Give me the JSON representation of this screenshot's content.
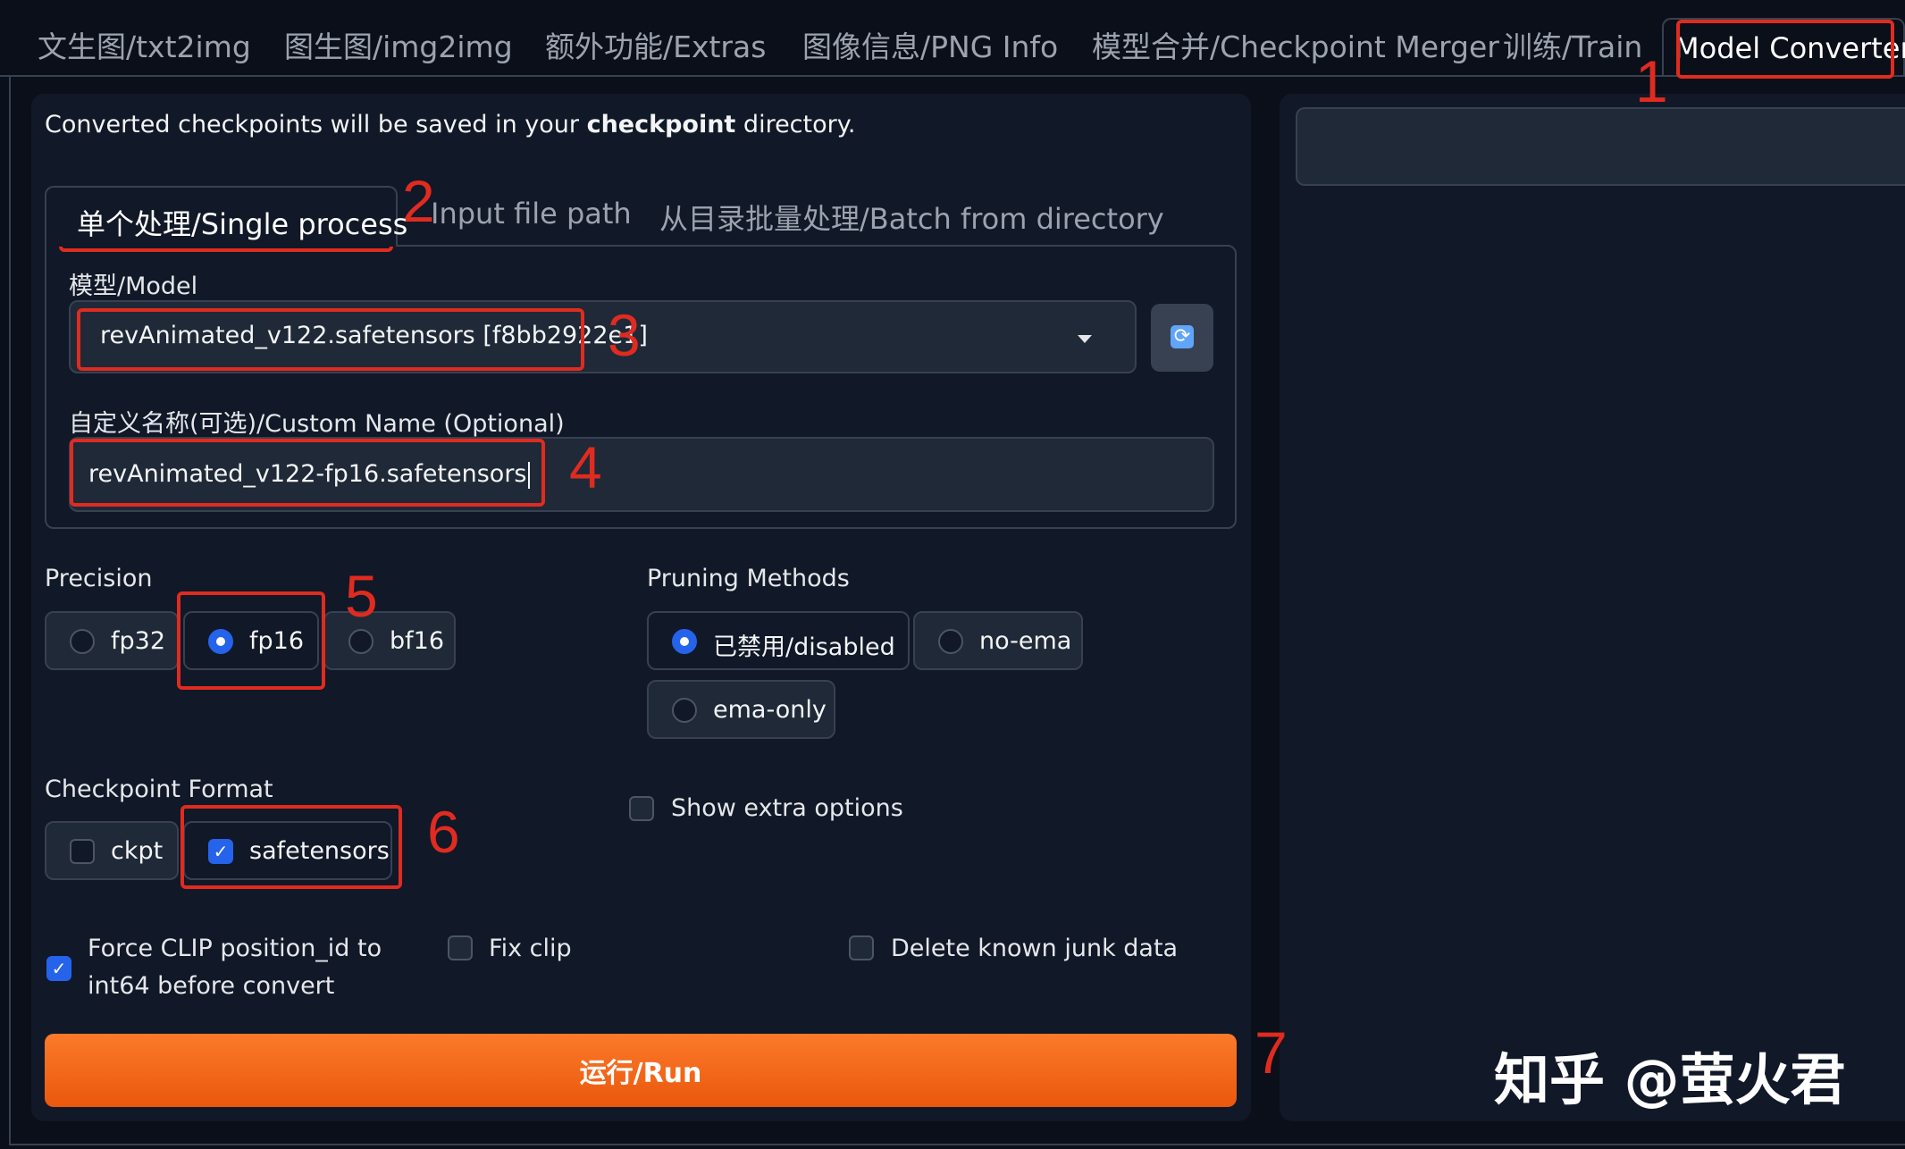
{
  "tabs": [
    {
      "label": "文生图/txt2img"
    },
    {
      "label": "图生图/img2img"
    },
    {
      "label": "额外功能/Extras"
    },
    {
      "label": "图像信息/PNG Info"
    },
    {
      "label": "模型合并/Checkpoint Merger"
    },
    {
      "label": "训练/Train"
    },
    {
      "label": "Model Converter"
    }
  ],
  "note": {
    "prefix": "Converted checkpoints will be saved in your ",
    "bold": "checkpoint",
    "suffix": " directory."
  },
  "subtabs": [
    {
      "label": "单个处理/Single process"
    },
    {
      "label": "Input file path"
    },
    {
      "label": "从目录批量处理/Batch from directory"
    }
  ],
  "model": {
    "label": "模型/Model",
    "value": "revAnimated_v122.safetensors [f8bb2922e1]",
    "refresh_icon": "refresh-icon"
  },
  "custom_name": {
    "label": "自定义名称(可选)/Custom Name (Optional)",
    "value": "revAnimated_v122-fp16.safetensors"
  },
  "precision": {
    "label": "Precision",
    "options": [
      "fp32",
      "fp16",
      "bf16"
    ],
    "selected": "fp16"
  },
  "pruning": {
    "label": "Pruning Methods",
    "options": [
      "已禁用/disabled",
      "no-ema",
      "ema-only"
    ],
    "selected": "已禁用/disabled"
  },
  "format": {
    "label": "Checkpoint Format",
    "options": [
      "ckpt",
      "safetensors"
    ],
    "checked": [
      "safetensors"
    ]
  },
  "extra": {
    "label": "Show extra options",
    "checked": false
  },
  "force_clip": {
    "line1": "Force CLIP position_id to",
    "line2": "int64 before convert",
    "checked": true
  },
  "fix_clip": {
    "label": "Fix clip",
    "checked": false
  },
  "delete_junk": {
    "label": "Delete known junk data",
    "checked": false
  },
  "run": {
    "label": "运行/Run"
  },
  "annotations": [
    "1",
    "2",
    "3",
    "4",
    "5",
    "6",
    "7"
  ],
  "watermark": "知乎 @萤火君",
  "colors": {
    "accent": "#2563eb",
    "run": "#f97316",
    "annotation": "#e02b20",
    "background": "#0b0f19"
  }
}
